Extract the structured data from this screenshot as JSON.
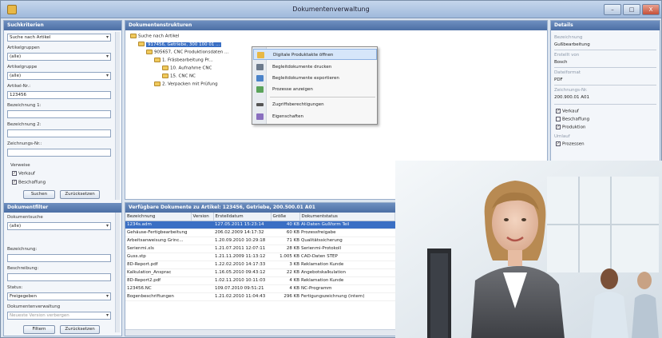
{
  "window": {
    "title": "Dokumentenverwaltung",
    "controls": [
      "–",
      "□",
      "X"
    ]
  },
  "search_panel": {
    "header": "Suchkriterien",
    "search_type": "Suche nach Artikel",
    "labels": {
      "artikelgruppe_a": "Artikelgruppen",
      "artikelgruppe_b": "Artikelgruppe",
      "artikelnr": "Artikel-Nr.:",
      "bezeichnung1": "Bezeichnung 1:",
      "bezeichnung2": "Bezeichnung 2:",
      "zeichnungsnr": "Zeichnungs-Nr.:",
      "verweise": "Verweise"
    },
    "values": {
      "artikelgruppe_a": "(alle)",
      "artikelgruppe_b": "(alle)",
      "artikelnr": "123456"
    },
    "checks": [
      {
        "label": "Verkauf",
        "checked": true
      },
      {
        "label": "Beschaffung",
        "checked": true
      }
    ],
    "buttons": {
      "search": "Suchen",
      "reset": "Zurücksetzen"
    }
  },
  "document_filter": {
    "header": "Dokumentfilter",
    "labels": {
      "dokumentsuche": "Dokumentsuche",
      "bezeichnung": "Bezeichnung:",
      "beschreibung": "Beschreibung:",
      "status": "Status:",
      "dokumentenverwaltung": "Dokumentenverwaltung"
    },
    "values": {
      "dokumentsuche": "(alle)",
      "status": "Freigegeben",
      "option": "Neueste Version verbergen"
    },
    "buttons": {
      "filter": "Filtern",
      "reset": "Zurücksetzen"
    }
  },
  "tree_panel": {
    "header": "Dokumentenstrukturen",
    "nodes": [
      {
        "label": "Suche nach Artikel"
      },
      {
        "label": "917456, Getriebe, 300 100 01 ..."
      },
      {
        "label": "905657, CNC Produktionsdaten ..."
      },
      {
        "label": "1. Fräsbearbeitung Pr..."
      },
      {
        "label": "10. Aufnahme CNC"
      },
      {
        "label": "15. CNC NC"
      },
      {
        "label": "2. Verpacken mit Prüfung"
      }
    ]
  },
  "context_menu": {
    "items": [
      {
        "label": "Digitale Produktakte öffnen",
        "icon": "folder-icon",
        "color": "#e8b846"
      },
      {
        "label": "Begleitdokumente drucken",
        "icon": "print-icon",
        "color": "#6c7a8c"
      },
      {
        "label": "Begleitdokumente exportieren",
        "icon": "export-icon",
        "color": "#4b83c9"
      },
      {
        "label": "Prozesse anzeigen",
        "icon": "process-icon",
        "color": "#5aa35a"
      },
      {
        "label": "Zugriffsberechtigungen",
        "icon": "key-icon",
        "color": "#555555"
      },
      {
        "label": "Eigenschaften",
        "icon": "properties-icon",
        "color": "#8a6fbf"
      }
    ]
  },
  "details_panel": {
    "header": "Details",
    "fields": [
      {
        "label": "Bezeichnung",
        "value": "Gußbearbeitung"
      },
      {
        "label": "Erstellt von",
        "value": "Bosch"
      },
      {
        "label": "Dateiformat",
        "value": "PDF"
      },
      {
        "label": "Zeichnungs-Nr.",
        "value": "200.900.01 A01"
      }
    ],
    "checks": [
      {
        "label": "Verkauf",
        "checked": true
      },
      {
        "label": "Beschaffung",
        "checked": false
      },
      {
        "label": "Produktion",
        "checked": true
      },
      {
        "label": "Prozessen",
        "checked": true
      }
    ],
    "section_label": "Umlauf"
  },
  "grid_panel": {
    "header": "Verfügbare Dokumente zu Artikel: 123456, Getriebe, 200.500.01 A01",
    "columns": [
      "Bezeichnung",
      "Version",
      "Erstelldatum",
      "Größe",
      "Dokumentstatus"
    ],
    "rows": [
      [
        "1234s.adm",
        "",
        "127.05.2011 15:23:14",
        "40 KB",
        "Al-Daten Gußform Teil"
      ],
      [
        "Gehäuse-Fertigbearbeitung",
        "",
        "206.02.2009 14:17:32",
        "60 KB",
        "Prozessfreigabe"
      ],
      [
        "Arbeitsanweisung Grinc...",
        "",
        "1.20.09.2010 10:29:18",
        "71 KB",
        "Qualitätssicherung"
      ],
      [
        "Serienmi.xls",
        "",
        "1.21.07.2011 12:07:11",
        "28 KB",
        "Serienmi-Protokoll"
      ],
      [
        "Guss.stp",
        "",
        "1.21.11.2009 11:13:12",
        "1.005 KB",
        "CAD-Daten STEP"
      ],
      [
        "8D-Report.pdf",
        "",
        "1.22.02.2010 14:17:33",
        "3 KB",
        "Reklamation Kunde"
      ],
      [
        "Kalkulation_Ansprac",
        "",
        "1.16.05.2010 09:43:12",
        "22 KB",
        "Angebotskalkulation"
      ],
      [
        "8D-Report2.pdf",
        "",
        "1.02.11.2010 10:11:03",
        "4 KB",
        "Reklamation Kunde"
      ],
      [
        "123456.NC",
        "",
        "109.07.2010 09:51:21",
        "4 KB",
        "NC-Programm"
      ],
      [
        "Bogenbeschriftungen",
        "",
        "1.21.02.2010 11:04:43",
        "296 KB",
        "Fertigungszeichnung (intern)"
      ]
    ]
  },
  "photo": {
    "subject": "Businesswoman smiling in front of a monitor, colleagues in background"
  }
}
